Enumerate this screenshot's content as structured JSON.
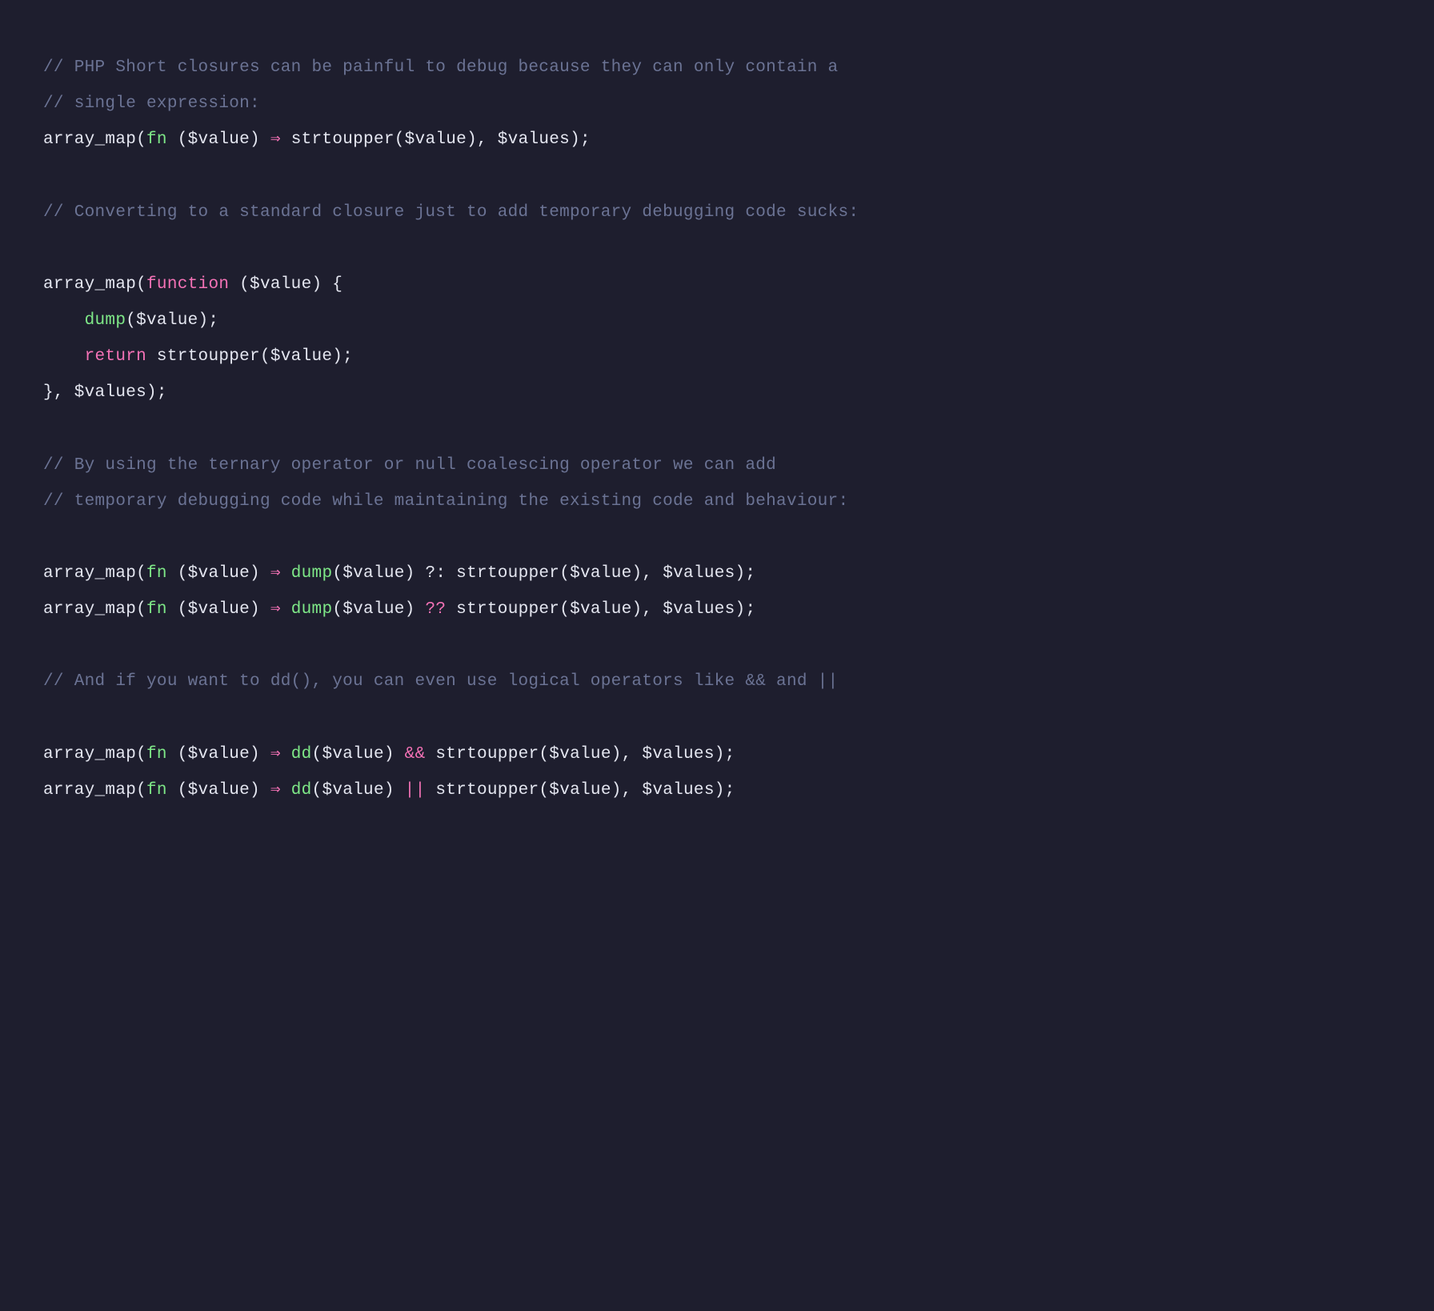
{
  "code": {
    "lines": [
      {
        "tokens": [
          {
            "text": "// PHP Short closures can be painful to debug because they can only contain a",
            "class": "tok-comment"
          }
        ]
      },
      {
        "tokens": [
          {
            "text": "// single expression:",
            "class": "tok-comment"
          }
        ]
      },
      {
        "tokens": [
          {
            "text": "array_map(",
            "class": "tok-default"
          },
          {
            "text": "fn",
            "class": "tok-fn"
          },
          {
            "text": " ($value) ",
            "class": "tok-default"
          },
          {
            "text": "⇒",
            "class": "tok-arrow"
          },
          {
            "text": " strtoupper($value), $values);",
            "class": "tok-default"
          }
        ]
      },
      {
        "blank": true
      },
      {
        "tokens": [
          {
            "text": "// Converting to a standard closure just to add temporary debugging code sucks:",
            "class": "tok-comment"
          }
        ]
      },
      {
        "blank": true
      },
      {
        "tokens": [
          {
            "text": "array_map(",
            "class": "tok-default"
          },
          {
            "text": "function",
            "class": "tok-keyword"
          },
          {
            "text": " ($value) {",
            "class": "tok-default"
          }
        ]
      },
      {
        "tokens": [
          {
            "text": "    ",
            "class": "tok-default"
          },
          {
            "text": "dump",
            "class": "tok-func"
          },
          {
            "text": "($value);",
            "class": "tok-default"
          }
        ]
      },
      {
        "tokens": [
          {
            "text": "    ",
            "class": "tok-default"
          },
          {
            "text": "return",
            "class": "tok-keyword"
          },
          {
            "text": " strtoupper($value);",
            "class": "tok-default"
          }
        ]
      },
      {
        "tokens": [
          {
            "text": "}, $values);",
            "class": "tok-default"
          }
        ]
      },
      {
        "blank": true
      },
      {
        "tokens": [
          {
            "text": "// By using the ternary operator or null coalescing operator we can add",
            "class": "tok-comment"
          }
        ]
      },
      {
        "tokens": [
          {
            "text": "// temporary debugging code while maintaining the existing code and behaviour:",
            "class": "tok-comment"
          }
        ]
      },
      {
        "blank": true
      },
      {
        "tokens": [
          {
            "text": "array_map(",
            "class": "tok-default"
          },
          {
            "text": "fn",
            "class": "tok-fn"
          },
          {
            "text": " ($value) ",
            "class": "tok-default"
          },
          {
            "text": "⇒",
            "class": "tok-arrow"
          },
          {
            "text": " ",
            "class": "tok-default"
          },
          {
            "text": "dump",
            "class": "tok-func"
          },
          {
            "text": "($value) ?: strtoupper($value), $values);",
            "class": "tok-default"
          }
        ]
      },
      {
        "tokens": [
          {
            "text": "array_map(",
            "class": "tok-default"
          },
          {
            "text": "fn",
            "class": "tok-fn"
          },
          {
            "text": " ($value) ",
            "class": "tok-default"
          },
          {
            "text": "⇒",
            "class": "tok-arrow"
          },
          {
            "text": " ",
            "class": "tok-default"
          },
          {
            "text": "dump",
            "class": "tok-func"
          },
          {
            "text": "($value) ",
            "class": "tok-default"
          },
          {
            "text": "??",
            "class": "tok-operator"
          },
          {
            "text": " strtoupper($value), $values);",
            "class": "tok-default"
          }
        ]
      },
      {
        "blank": true
      },
      {
        "tokens": [
          {
            "text": "// And if you want to dd(), you can even use logical operators like && and ||",
            "class": "tok-comment"
          }
        ]
      },
      {
        "blank": true
      },
      {
        "tokens": [
          {
            "text": "array_map(",
            "class": "tok-default"
          },
          {
            "text": "fn",
            "class": "tok-fn"
          },
          {
            "text": " ($value) ",
            "class": "tok-default"
          },
          {
            "text": "⇒",
            "class": "tok-arrow"
          },
          {
            "text": " ",
            "class": "tok-default"
          },
          {
            "text": "dd",
            "class": "tok-func"
          },
          {
            "text": "($value) ",
            "class": "tok-default"
          },
          {
            "text": "&&",
            "class": "tok-operator"
          },
          {
            "text": " strtoupper($value), $values);",
            "class": "tok-default"
          }
        ]
      },
      {
        "tokens": [
          {
            "text": "array_map(",
            "class": "tok-default"
          },
          {
            "text": "fn",
            "class": "tok-fn"
          },
          {
            "text": " ($value) ",
            "class": "tok-default"
          },
          {
            "text": "⇒",
            "class": "tok-arrow"
          },
          {
            "text": " ",
            "class": "tok-default"
          },
          {
            "text": "dd",
            "class": "tok-func"
          },
          {
            "text": "($value) ",
            "class": "tok-default"
          },
          {
            "text": "||",
            "class": "tok-operator"
          },
          {
            "text": " strtoupper($value), $values);",
            "class": "tok-default"
          }
        ]
      }
    ]
  }
}
